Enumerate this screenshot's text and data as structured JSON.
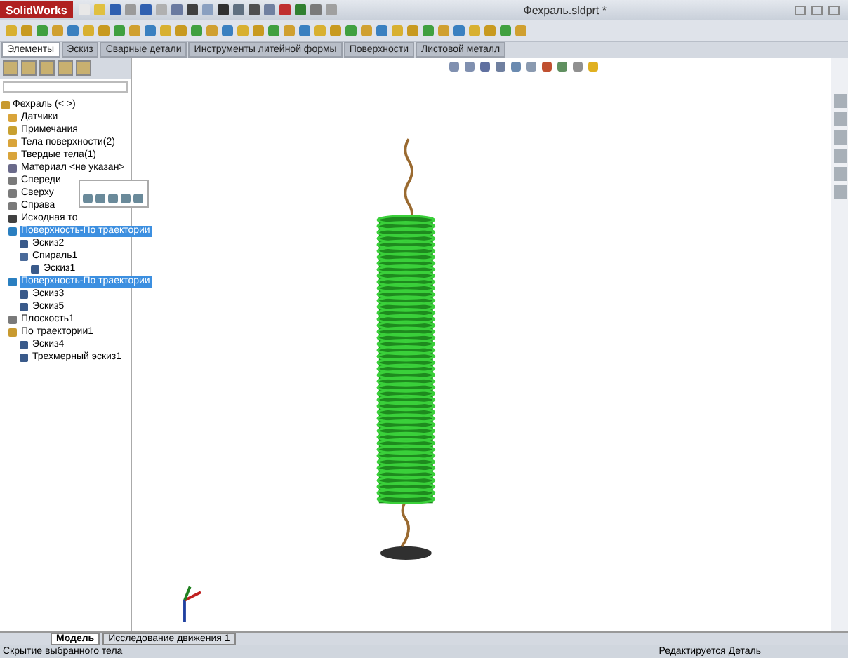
{
  "window": {
    "app": "SolidWorks",
    "title": "Фехраль.sldprt *"
  },
  "command_tabs": [
    {
      "label": "Элементы",
      "selected": true
    },
    {
      "label": "Эскиз",
      "selected": false
    },
    {
      "label": "Сварные детали",
      "selected": false
    },
    {
      "label": "Инструменты литейной формы",
      "selected": false
    },
    {
      "label": "Поверхности",
      "selected": false
    },
    {
      "label": "Листовой металл",
      "selected": false
    }
  ],
  "tree": {
    "root": "Фехраль  (< >)",
    "items": [
      {
        "label": "Датчики",
        "kind": "folder",
        "selected": false
      },
      {
        "label": "Примечания",
        "kind": "annotation",
        "selected": false
      },
      {
        "label": "Тела поверхности(2)",
        "kind": "folder",
        "selected": false
      },
      {
        "label": "Твердые тела(1)",
        "kind": "folder",
        "selected": false
      },
      {
        "label": "Материал <не указан>",
        "kind": "material",
        "selected": false
      },
      {
        "label": "Спереди",
        "kind": "plane",
        "selected": false
      },
      {
        "label": "Сверху",
        "kind": "plane",
        "selected": false
      },
      {
        "label": "Справа",
        "kind": "plane",
        "selected": false
      },
      {
        "label": "Исходная то",
        "kind": "origin",
        "selected": false
      },
      {
        "label": "Поверхность-По траектории",
        "kind": "feature",
        "selected": true,
        "children": [
          {
            "label": "Эскиз2",
            "kind": "sketch",
            "selected": false
          },
          {
            "label": "Спираль1",
            "kind": "helix",
            "selected": false,
            "children": [
              {
                "label": "Эскиз1",
                "kind": "sketch",
                "selected": false
              }
            ]
          }
        ]
      },
      {
        "label": "Поверхность-По траектории",
        "kind": "feature",
        "selected": true,
        "children": [
          {
            "label": "Эскиз3",
            "kind": "sketch",
            "selected": false
          },
          {
            "label": "Эскиз5",
            "kind": "sketch",
            "selected": false
          }
        ]
      },
      {
        "label": "Плоскость1",
        "kind": "plane",
        "selected": false
      },
      {
        "label": "По траектории1",
        "kind": "sweep",
        "selected": false,
        "children": [
          {
            "label": "Эскиз4",
            "kind": "sketch",
            "selected": false
          },
          {
            "label": "Трехмерный эскиз1",
            "kind": "sketch",
            "selected": false
          }
        ]
      }
    ]
  },
  "bottom_tabs": [
    {
      "label": "Модель",
      "selected": true
    },
    {
      "label": "Исследование движения 1",
      "selected": false
    }
  ],
  "status_bar": {
    "message": "Скрытие выбранного тела",
    "mode": "Редактируется Деталь"
  }
}
